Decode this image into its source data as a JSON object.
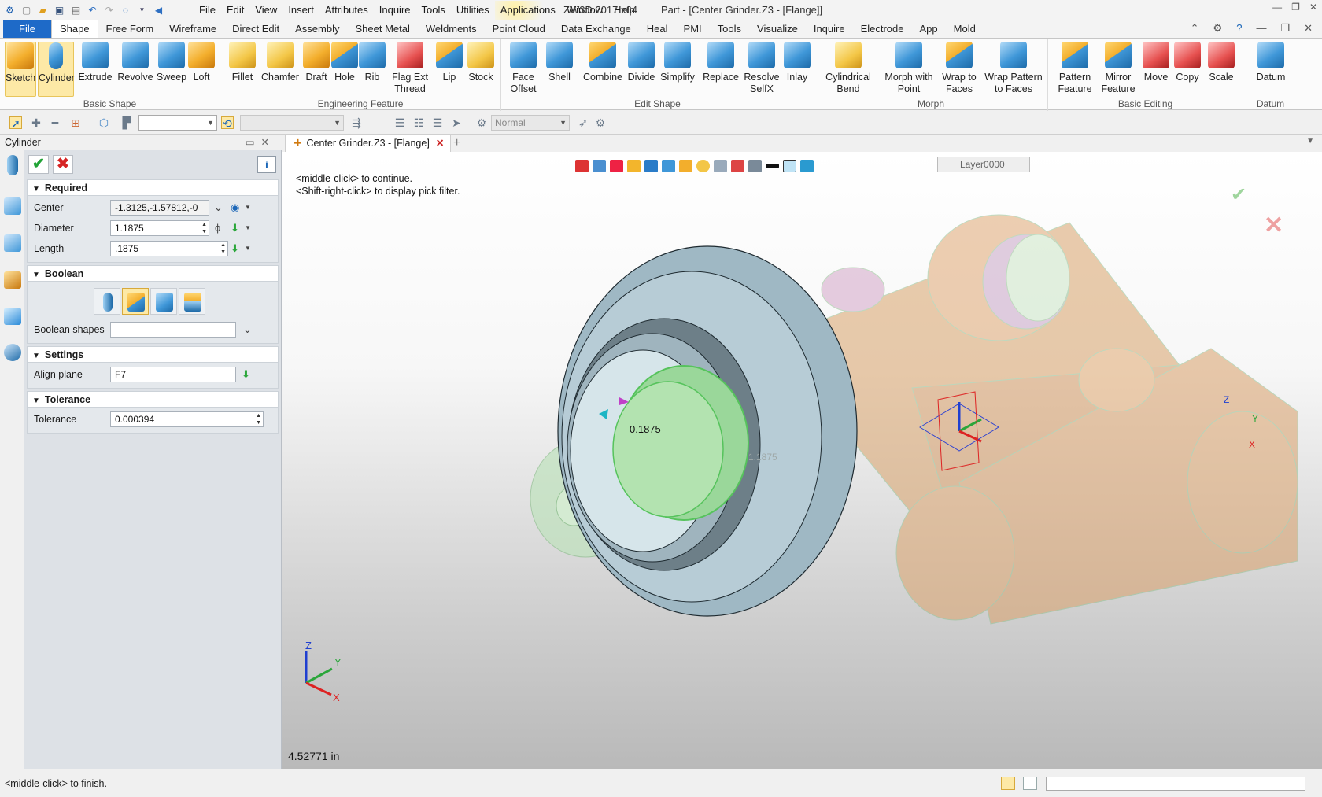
{
  "window": {
    "app_title": "ZW3D 2017  x64",
    "doc_title": "Part - [Center Grinder.Z3 - [Flange]]"
  },
  "menu": [
    "File",
    "Edit",
    "View",
    "Insert",
    "Attributes",
    "Inquire",
    "Tools",
    "Utilities",
    "Applications",
    "Window",
    "Help"
  ],
  "ribbon_tabs": [
    "File",
    "Shape",
    "Free Form",
    "Wireframe",
    "Direct Edit",
    "Assembly",
    "Sheet Metal",
    "Weldments",
    "Point Cloud",
    "Data Exchange",
    "Heal",
    "PMI",
    "Tools",
    "Visualize",
    "Inquire",
    "Electrode",
    "App",
    "Mold"
  ],
  "active_tab": "Shape",
  "ribbon_groups": {
    "basic_shape": {
      "name": "Basic Shape",
      "buttons": [
        "Sketch",
        "Cylinder",
        "Extrude",
        "Revolve",
        "Sweep",
        "Loft"
      ]
    },
    "engineering_feature": {
      "name": "Engineering Feature",
      "buttons": [
        "Fillet",
        "Chamfer",
        "Draft",
        "Hole",
        "Rib",
        "Flag Ext\nThread",
        "Lip",
        "Stock"
      ]
    },
    "edit_shape": {
      "name": "Edit Shape",
      "buttons": [
        "Face\nOffset",
        "Shell",
        "Combine",
        "Divide",
        "Simplify",
        "Replace",
        "Resolve\nSelfX",
        "Inlay"
      ]
    },
    "morph": {
      "name": "Morph",
      "buttons": [
        "Cylindrical\nBend",
        "Morph with\nPoint",
        "Wrap to\nFaces",
        "Wrap Pattern\nto Faces"
      ]
    },
    "basic_editing": {
      "name": "Basic Editing",
      "buttons": [
        "Pattern\nFeature",
        "Mirror\nFeature",
        "Move",
        "Copy",
        "Scale"
      ]
    },
    "datum": {
      "name": "Datum",
      "buttons": [
        "Datum"
      ]
    }
  },
  "toolbar": {
    "render_mode": "Normal"
  },
  "panel": {
    "title": "Cylinder",
    "sections": {
      "required": "Required",
      "boolean": "Boolean",
      "settings": "Settings",
      "tolerance": "Tolerance"
    },
    "fields": {
      "center_label": "Center",
      "center_value": "-1.3125,-1.57812,-0",
      "diameter_label": "Diameter",
      "diameter_value": "1.1875",
      "length_label": "Length",
      "length_value": ".1875",
      "boolean_shapes_label": "Boolean shapes",
      "boolean_shapes_value": "",
      "align_plane_label": "Align plane",
      "align_plane_value": "F7",
      "tolerance_label": "Tolerance",
      "tolerance_value": "0.000394"
    }
  },
  "document_tab": "Center Grinder.Z3 - [Flange]",
  "viewport": {
    "hint_line1": "<middle-click> to continue.",
    "hint_line2": "<Shift-right-click> to display pick filter.",
    "layer": "Layer0000",
    "dimension_length": "0.1875",
    "dimension_diameter": "1.1875",
    "coordinate_readout": "4.52771 in",
    "axis_x": "X",
    "axis_y": "Y",
    "axis_z": "Z"
  },
  "statusbar": {
    "message": "<middle-click> to finish."
  }
}
